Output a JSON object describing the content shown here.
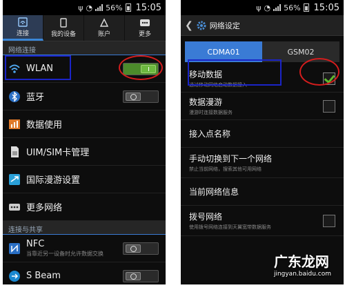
{
  "status_bar": {
    "battery": "56%",
    "time": "15:05"
  },
  "left": {
    "tabs": [
      {
        "label": "连接",
        "icon": "connections-icon",
        "active": true
      },
      {
        "label": "我的设备",
        "icon": "device-icon",
        "active": false
      },
      {
        "label": "账户",
        "icon": "accounts-icon",
        "active": false
      },
      {
        "label": "更多",
        "icon": "more-dots-icon",
        "active": false
      }
    ],
    "section_network": "网络连接",
    "items": [
      {
        "label": "WLAN",
        "icon": "wifi-icon",
        "toggle": "on"
      },
      {
        "label": "蓝牙",
        "icon": "bluetooth-icon",
        "toggle": "off"
      },
      {
        "label": "数据使用",
        "icon": "data-usage-icon"
      },
      {
        "label": "UIM/SIM卡管理",
        "icon": "sim-card-icon"
      },
      {
        "label": "国际漫游设置",
        "icon": "roaming-icon"
      },
      {
        "label": "更多网络",
        "icon": "more-networks-icon"
      }
    ],
    "section_share": "连接与共享",
    "share_items": [
      {
        "label": "NFC",
        "sub": "当靠近另一设备时允许数据交换",
        "icon": "nfc-icon",
        "toggle": "off"
      },
      {
        "label": "S Beam",
        "icon": "s-beam-icon",
        "toggle": "off"
      }
    ]
  },
  "right": {
    "title": "网络设定",
    "sim_tabs": [
      {
        "label": "CDMA01",
        "active": true
      },
      {
        "label": "GSM02",
        "active": false
      }
    ],
    "items": [
      {
        "label": "移动数据",
        "sub": "通过移动网络启动数据接入",
        "checkbox": true,
        "checked": true
      },
      {
        "label": "数据漫游",
        "sub": "漫游时连接数据服务",
        "checkbox": true,
        "checked": false
      },
      {
        "label": "接入点名称"
      },
      {
        "label": "手动切换到下一个网络",
        "sub": "禁止当前网络，搜索其他可用网络"
      },
      {
        "label": "当前网络信息"
      },
      {
        "label": "拨号网络",
        "sub": "使用拨号网络连接到天翼宽带数据服务",
        "checkbox": true,
        "checked": false
      }
    ]
  },
  "watermark": {
    "brand": "广东龙网",
    "url": "jingyan.baidu.com"
  },
  "colors": {
    "accent": "#3a7bd5",
    "toggle_on": "#6cb83f",
    "highlight_blue": "#1a24c8",
    "highlight_red": "#d41d1d"
  }
}
